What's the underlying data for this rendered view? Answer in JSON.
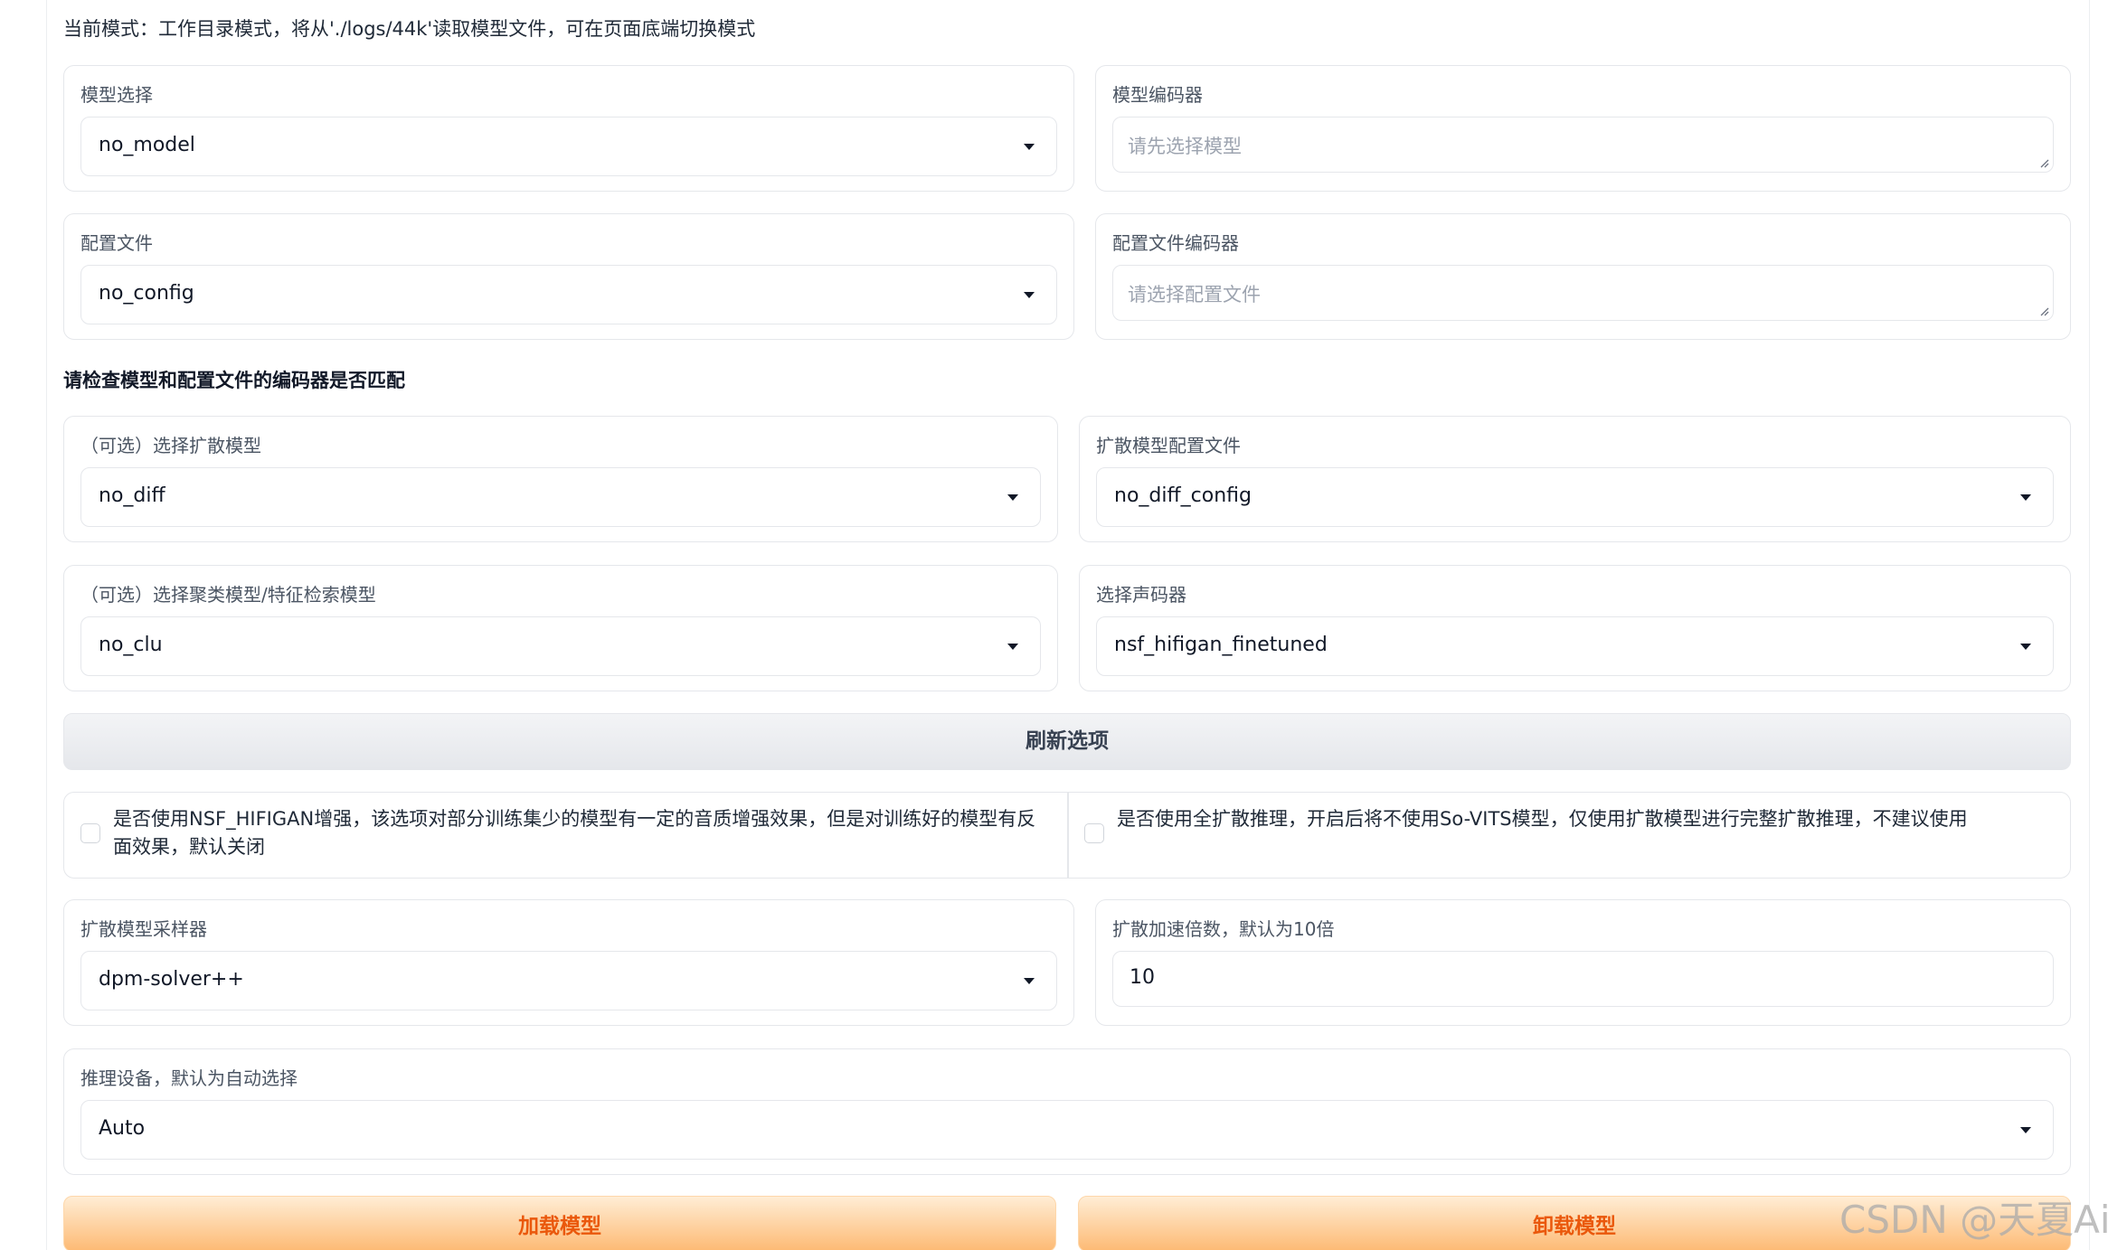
{
  "mode_notice": "当前模式：工作目录模式，将从'./logs/44k'读取模型文件，可在页面底端切换模式",
  "model_select": {
    "label": "模型选择",
    "value": "no_model"
  },
  "model_encoder": {
    "label": "模型编码器",
    "placeholder": "请先选择模型"
  },
  "config_file": {
    "label": "配置文件",
    "value": "no_config"
  },
  "config_encoder": {
    "label": "配置文件编码器",
    "placeholder": "请选择配置文件"
  },
  "encoder_check_heading": "请检查模型和配置文件的编码器是否匹配",
  "diffusion_model": {
    "label": "（可选）选择扩散模型",
    "value": "no_diff"
  },
  "diffusion_config": {
    "label": "扩散模型配置文件",
    "value": "no_diff_config"
  },
  "cluster_model": {
    "label": "（可选）选择聚类模型/特征检索模型",
    "value": "no_clu"
  },
  "vocoder": {
    "label": "选择声码器",
    "value": "nsf_hifigan_finetuned"
  },
  "refresh_button": "刷新选项",
  "nsf_hifigan_checkbox": {
    "label": "是否使用NSF_HIFIGAN增强，该选项对部分训练集少的模型有一定的音质增强效果，但是对训练好的模型有反面效果，默认关闭",
    "checked": false
  },
  "full_diffusion_checkbox": {
    "label": "是否使用全扩散推理，开启后将不使用So-VITS模型，仅使用扩散模型进行完整扩散推理，不建议使用",
    "checked": false
  },
  "diffusion_sampler": {
    "label": "扩散模型采样器",
    "value": "dpm-solver++"
  },
  "diffusion_speedup": {
    "label": "扩散加速倍数，默认为10倍",
    "value": "10"
  },
  "inference_device": {
    "label": "推理设备，默认为自动选择",
    "value": "Auto"
  },
  "load_button": "加载模型",
  "unload_button": "卸载模型",
  "watermark": "CSDN @天夏Ai",
  "colors": {
    "accent_orange": "#ea580c",
    "button_gradient_light": "#ffedd5",
    "button_gradient_dark": "#fdba74",
    "border": "#e5e7eb",
    "placeholder": "#9ca3af"
  }
}
